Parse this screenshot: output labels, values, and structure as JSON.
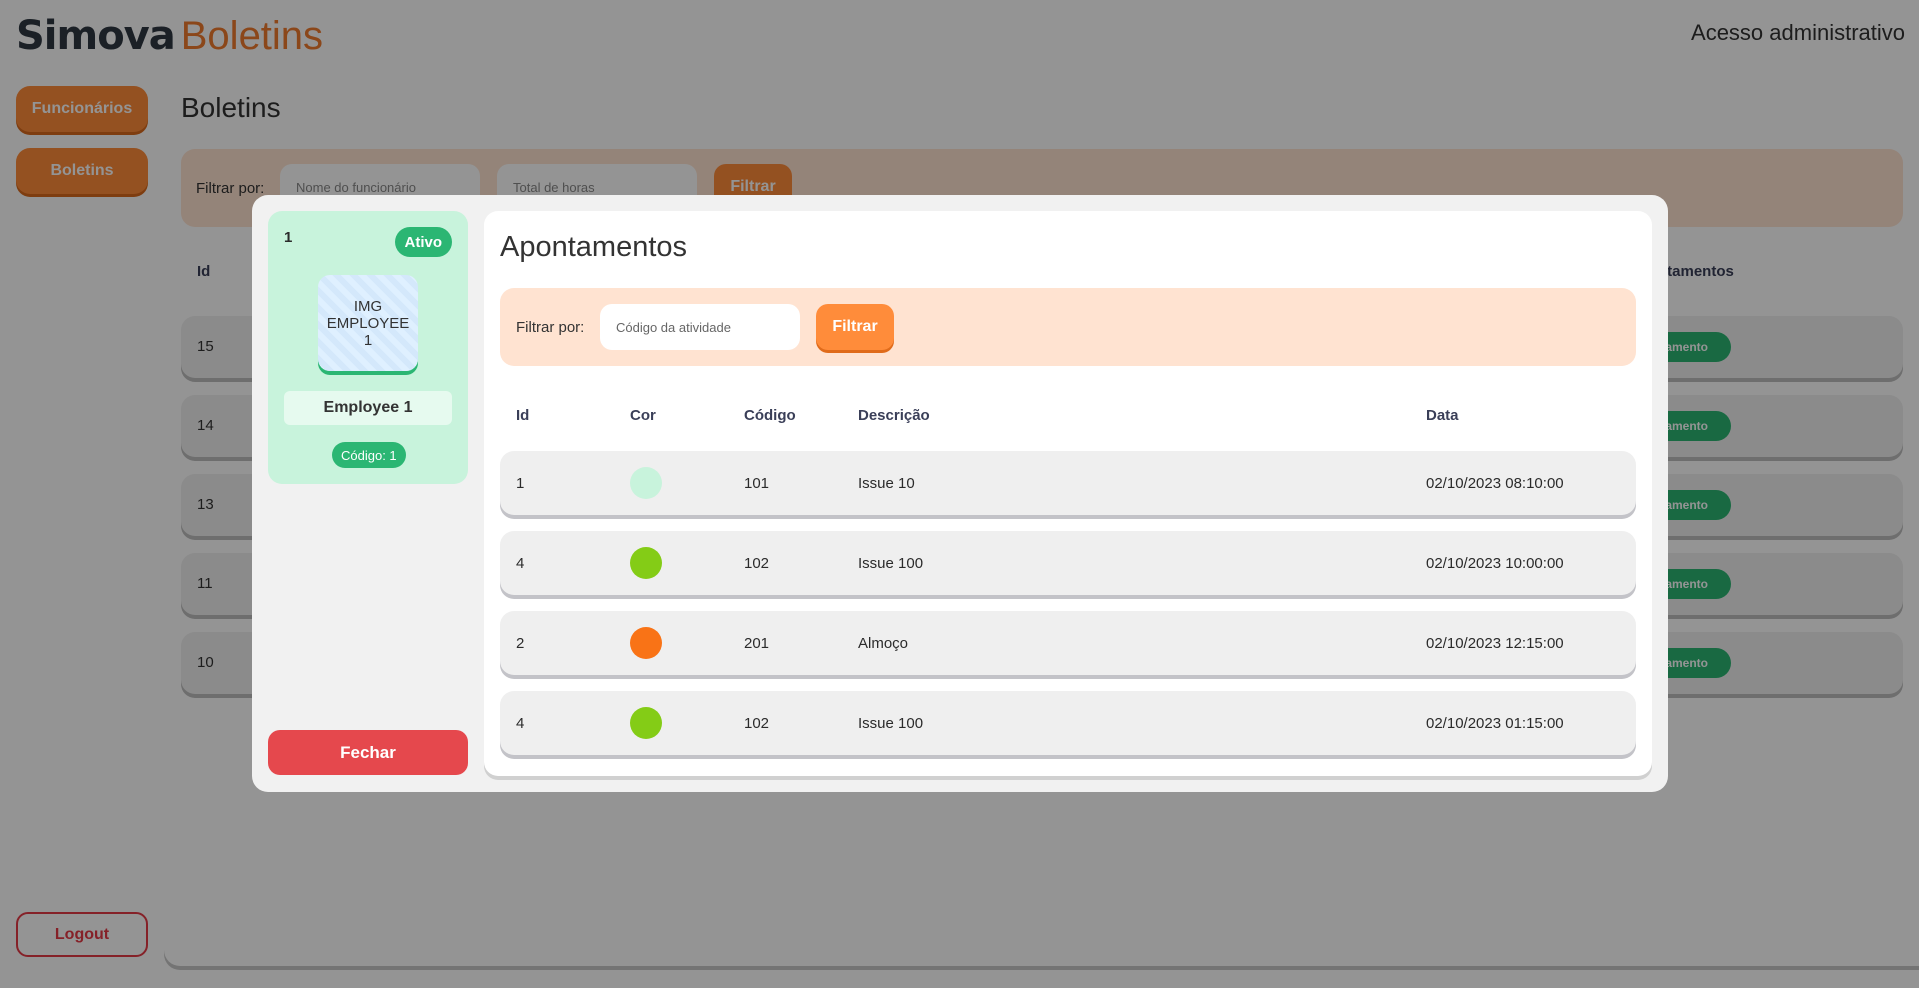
{
  "header": {
    "brand_strong": "Simova",
    "brand_light": "Boletins",
    "admin_link": "Acesso administrativo"
  },
  "sidebar": {
    "items": [
      {
        "label": "Funcionários"
      },
      {
        "label": "Boletins"
      }
    ],
    "logout": "Logout"
  },
  "page": {
    "title": "Boletins",
    "filter_label": "Filtrar por:",
    "filter_inputs": [
      {
        "placeholder": "Nome do funcionário"
      },
      {
        "placeholder": "Total de horas"
      }
    ],
    "filter_button": "Filtrar",
    "columns": {
      "id": "Id",
      "apontamentos": "ntamentos"
    },
    "rows": [
      {
        "id": "15",
        "badge": "ntamento"
      },
      {
        "id": "14",
        "badge": "ntamento"
      },
      {
        "id": "13",
        "badge": "ntamento"
      },
      {
        "id": "11",
        "badge": "ntamento"
      },
      {
        "id": "10",
        "badge": "ntamento"
      }
    ]
  },
  "modal": {
    "employee": {
      "id": "1",
      "status": "Ativo",
      "image_text": "IMG EMPLOYEE 1",
      "name": "Employee 1",
      "code": "Código: 1"
    },
    "close_button": "Fechar",
    "title": "Apontamentos",
    "filter": {
      "label": "Filtrar por:",
      "placeholder": "Código da atividade",
      "button": "Filtrar"
    },
    "columns": {
      "id": "Id",
      "cor": "Cor",
      "codigo": "Código",
      "descricao": "Descrição",
      "data": "Data"
    },
    "rows": [
      {
        "id": "1",
        "color": "#c8f3dc",
        "codigo": "101",
        "descricao": "Issue 10",
        "data": "02/10/2023 08:10:00"
      },
      {
        "id": "4",
        "color": "#84cc16",
        "codigo": "102",
        "descricao": "Issue 100",
        "data": "02/10/2023 10:00:00"
      },
      {
        "id": "2",
        "color": "#f97316",
        "codigo": "201",
        "descricao": "Almoço",
        "data": "02/10/2023 12:15:00"
      },
      {
        "id": "4",
        "color": "#84cc16",
        "codigo": "102",
        "descricao": "Issue 100",
        "data": "02/10/2023 01:15:00"
      }
    ]
  },
  "colors": {
    "accent": "#ff8c3a",
    "success": "#2bb673",
    "danger": "#e5484d",
    "filter_bg": "#ffe3d1",
    "card_bg": "#c8f3dc"
  }
}
